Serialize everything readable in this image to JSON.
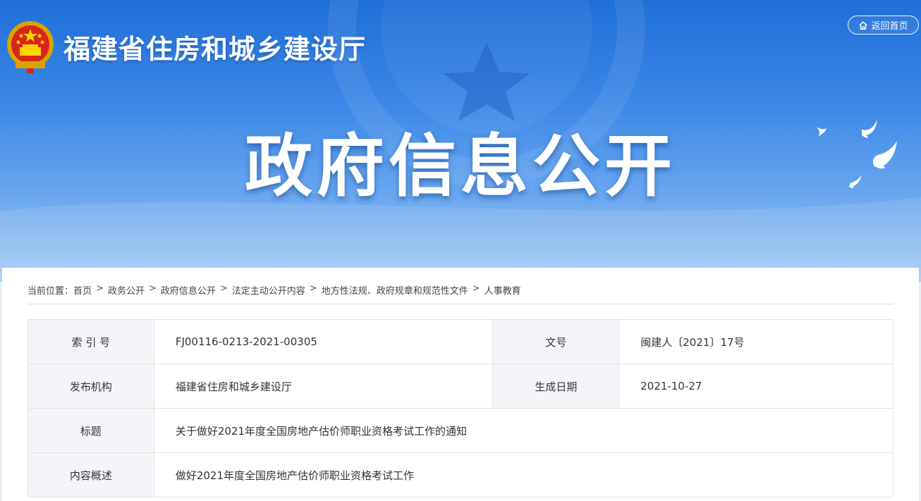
{
  "header": {
    "site_name": "福建省住房和城乡建设厅",
    "home_button": "返回首页",
    "hero_title": "政府信息公开"
  },
  "icons": {
    "emblem": "national-emblem-icon",
    "home": "home-icon",
    "doves": "doves-icon"
  },
  "colors": {
    "banner_top": "#1f6fd6",
    "banner_bottom": "#a9ccf5",
    "label_bg": "#f4f5f9"
  },
  "breadcrumb": {
    "prefix": "当前位置：",
    "separator": ">",
    "items": [
      "首页",
      "政务公开",
      "政府信息公开",
      "法定主动公开内容",
      "地方性法规、政府规章和规范性文件",
      "人事教育"
    ]
  },
  "info": {
    "index_label": "索 引 号",
    "index_value": "FJ00116-0213-2021-00305",
    "docno_label": "文号",
    "docno_value": "闽建人〔2021〕17号",
    "publisher_label": "发布机构",
    "publisher_value": "福建省住房和城乡建设厅",
    "date_label": "生成日期",
    "date_value": "2021-10-27",
    "title_label": "标题",
    "title_value": "关于做好2021年度全国房地产估价师职业资格考试工作的通知",
    "summary_label": "内容概述",
    "summary_value": "做好2021年度全国房地产估价师职业资格考试工作"
  }
}
